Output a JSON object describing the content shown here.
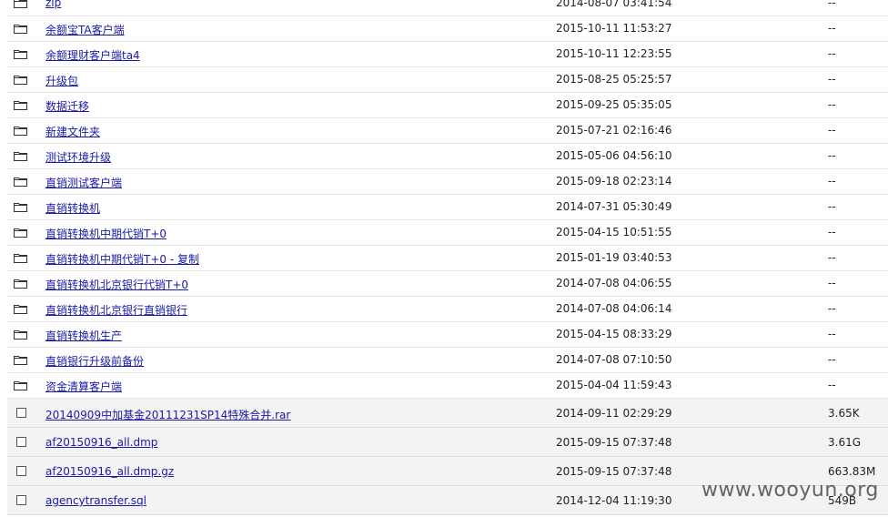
{
  "folders": [
    {
      "name": "zip",
      "date": "2014-08-07 03:41:54",
      "size": "--"
    },
    {
      "name": "余额宝TA客户端",
      "date": "2015-10-11 11:53:27",
      "size": "--"
    },
    {
      "name": "余额理财客户端ta4",
      "date": "2015-10-11 12:23:55",
      "size": "--"
    },
    {
      "name": "升级包",
      "date": "2015-08-25 05:25:57",
      "size": "--"
    },
    {
      "name": "数据迁移",
      "date": "2015-09-25 05:35:05",
      "size": "--"
    },
    {
      "name": "新建文件夹",
      "date": "2015-07-21 02:16:46",
      "size": "--"
    },
    {
      "name": "测试环境升级",
      "date": "2015-05-06 04:56:10",
      "size": "--"
    },
    {
      "name": "直销测试客户端",
      "date": "2015-09-18 02:23:14",
      "size": "--"
    },
    {
      "name": "直销转换机",
      "date": "2014-07-31 05:30:49",
      "size": "--"
    },
    {
      "name": "直销转换机中期代销T+0",
      "date": "2015-04-15 10:51:55",
      "size": "--"
    },
    {
      "name": "直销转换机中期代销T+0 - 复制",
      "date": "2015-01-19 03:40:53",
      "size": "--"
    },
    {
      "name": "直销转换机北京银行代销T+0",
      "date": "2014-07-08 04:06:55",
      "size": "--"
    },
    {
      "name": "直销转换机北京银行直销银行",
      "date": "2014-07-08 04:06:14",
      "size": "--"
    },
    {
      "name": "直销转换机生产",
      "date": "2015-04-15 08:33:29",
      "size": "--"
    },
    {
      "name": "直销银行升级前备份",
      "date": "2014-07-08 07:10:50",
      "size": "--"
    },
    {
      "name": "资金清算客户端",
      "date": "2015-04-04 11:59:43",
      "size": "--"
    }
  ],
  "files": [
    {
      "name": "20140909中加基金20111231SP14特殊合并.rar",
      "date": "2014-09-11 02:29:29",
      "size": "3.65K"
    },
    {
      "name": "af20150916_all.dmp",
      "date": "2015-09-15 07:37:48",
      "size": "3.61G"
    },
    {
      "name": "af20150916_all.dmp.gz",
      "date": "2015-09-15 07:37:48",
      "size": "663.83M"
    },
    {
      "name": "agencytransfer.sql",
      "date": "2014-12-04 11:19:30",
      "size": "549B"
    }
  ],
  "watermark": "www.wooyun.org",
  "icons": {
    "folder": "folder-icon",
    "file": "file-checkbox-icon"
  }
}
